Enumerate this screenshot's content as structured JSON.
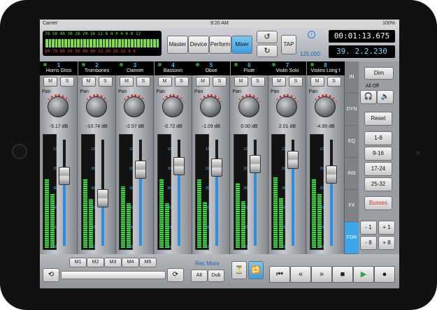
{
  "status": {
    "carrier": "Carrier",
    "time": "8:20 AM",
    "battery": "100%"
  },
  "meter_labels": {
    "top": "78 58 48 38 28 20 16 12  8  4  0 4 6 8 12",
    "bottom": "80 70 60 56 50 48 40 32 30 16 12 8  4"
  },
  "topbar": {
    "buttons": [
      "Master",
      "Device",
      "Perform",
      "Mixer"
    ],
    "active": "Mixer",
    "tap": "TAP",
    "tempo": "125.000",
    "time_counter": "00:01:13.675",
    "bar_counter": "39. 2.2.230",
    "info": "i"
  },
  "channels": [
    {
      "num": "1",
      "name": "Horns Gliss",
      "db": "-5.17 dB",
      "fader": 0.66,
      "meterL": 0.62,
      "meterR": 0.48
    },
    {
      "num": "2",
      "name": "Trombones",
      "db": "-10.74 dB",
      "fader": 0.45,
      "meterL": 0.62,
      "meterR": 0.44
    },
    {
      "num": "3",
      "name": "Clarinet",
      "db": "-2.57 dB",
      "fader": 0.72,
      "meterL": 0.55,
      "meterR": 0.4
    },
    {
      "num": "4",
      "name": "Bassoon",
      "db": "-0.72 dB",
      "fader": 0.75,
      "meterL": 0.62,
      "meterR": 0.4
    },
    {
      "num": "5",
      "name": "Oboe",
      "db": "-1.09 dB",
      "fader": 0.74,
      "meterL": 0.61,
      "meterR": 0.41
    },
    {
      "num": "6",
      "name": "Flute",
      "db": "0.00 dB",
      "fader": 0.77,
      "meterL": 0.58,
      "meterR": 0.42
    },
    {
      "num": "7",
      "name": "Violin Solo",
      "db": "2.01 dB",
      "fader": 0.81,
      "meterL": 0.63,
      "meterR": 0.45
    },
    {
      "num": "8",
      "name": "Violins Long f",
      "db": "-4.95 dB",
      "fader": 0.67,
      "meterL": 0.62,
      "meterR": 0.48
    }
  ],
  "mute": "M",
  "solo": "S",
  "pan_label": "Pan",
  "meter_scale": [
    "12",
    "20",
    "30",
    "40",
    "50",
    "56"
  ],
  "side_tabs": [
    "IN",
    "DYN",
    "EQ",
    "INS",
    "FX",
    "FDR"
  ],
  "active_tab": "FDR",
  "side": {
    "dim": "Dim",
    "all_off": "All Off",
    "reset": "Reset",
    "ranges": [
      "1-8",
      "9-16",
      "17-24",
      "25-32"
    ],
    "busses": "Busses",
    "steps": [
      "- 1",
      "+ 1",
      "- 8",
      "+ 8"
    ]
  },
  "bottom": {
    "memories": [
      "M1",
      "M2",
      "M3",
      "M4",
      "M5"
    ],
    "rec_more": "Rec More",
    "alt": "Alt",
    "dub": "Dub"
  },
  "colors": {
    "accent": "#3aa5e8",
    "meter": "#45d64a",
    "busses": "#d32f2f"
  }
}
